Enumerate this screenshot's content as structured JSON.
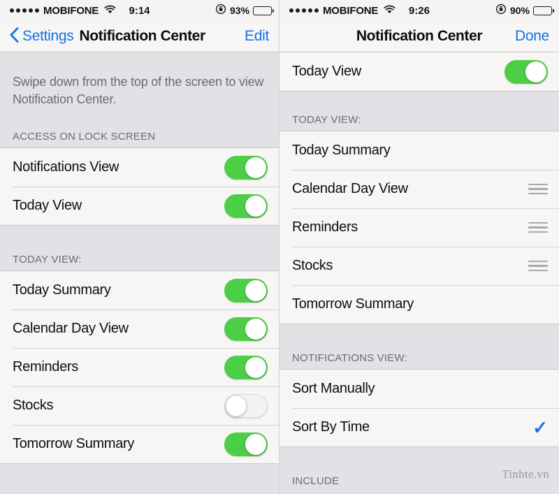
{
  "left": {
    "statusbar": {
      "signal_dots": 5,
      "carrier": "MOBIFONE",
      "wifi_icon": "wifi-icon",
      "time": "9:14",
      "rotation_lock_icon": "rotation-lock-icon",
      "battery_percent": "93%",
      "battery_level": 93
    },
    "navbar": {
      "back_icon": "chevron-left-icon",
      "back_label": "Settings",
      "title": "Notification Center",
      "action_label": "Edit"
    },
    "blurb": "Swipe down from the top of the screen to view Notification Center.",
    "sections": [
      {
        "header": "ACCESS ON LOCK SCREEN",
        "rows": [
          {
            "label": "Notifications View",
            "control": "toggle",
            "state": "on"
          },
          {
            "label": "Today View",
            "control": "toggle",
            "state": "on"
          }
        ]
      },
      {
        "header": "TODAY VIEW:",
        "rows": [
          {
            "label": "Today Summary",
            "control": "toggle",
            "state": "on"
          },
          {
            "label": "Calendar Day View",
            "control": "toggle",
            "state": "on"
          },
          {
            "label": "Reminders",
            "control": "toggle",
            "state": "on"
          },
          {
            "label": "Stocks",
            "control": "toggle",
            "state": "off"
          },
          {
            "label": "Tomorrow Summary",
            "control": "toggle",
            "state": "on"
          }
        ]
      }
    ]
  },
  "right": {
    "statusbar": {
      "signal_dots": 5,
      "carrier": "MOBIFONE",
      "wifi_icon": "wifi-icon",
      "time": "9:26",
      "rotation_lock_icon": "rotation-lock-icon",
      "battery_percent": "90%",
      "battery_level": 90
    },
    "navbar": {
      "title": "Notification Center",
      "action_label": "Done"
    },
    "top_rows": [
      {
        "label": "Today View",
        "control": "toggle",
        "state": "on"
      }
    ],
    "sections": [
      {
        "header": "TODAY VIEW:",
        "rows": [
          {
            "label": "Today Summary",
            "control": "none"
          },
          {
            "label": "Calendar Day View",
            "control": "handle"
          },
          {
            "label": "Reminders",
            "control": "handle"
          },
          {
            "label": "Stocks",
            "control": "handle"
          },
          {
            "label": "Tomorrow Summary",
            "control": "none"
          }
        ]
      },
      {
        "header": "NOTIFICATIONS VIEW:",
        "rows": [
          {
            "label": "Sort Manually",
            "control": "none"
          },
          {
            "label": "Sort By Time",
            "control": "check"
          }
        ]
      }
    ],
    "include_header": "INCLUDE",
    "watermark": "Tinhte.vn"
  },
  "colors": {
    "toggle_on": "#4ccf46",
    "tint_blue": "#1272e8",
    "group_bg": "#f7f6f5",
    "page_bg": "#e3e1e6"
  }
}
